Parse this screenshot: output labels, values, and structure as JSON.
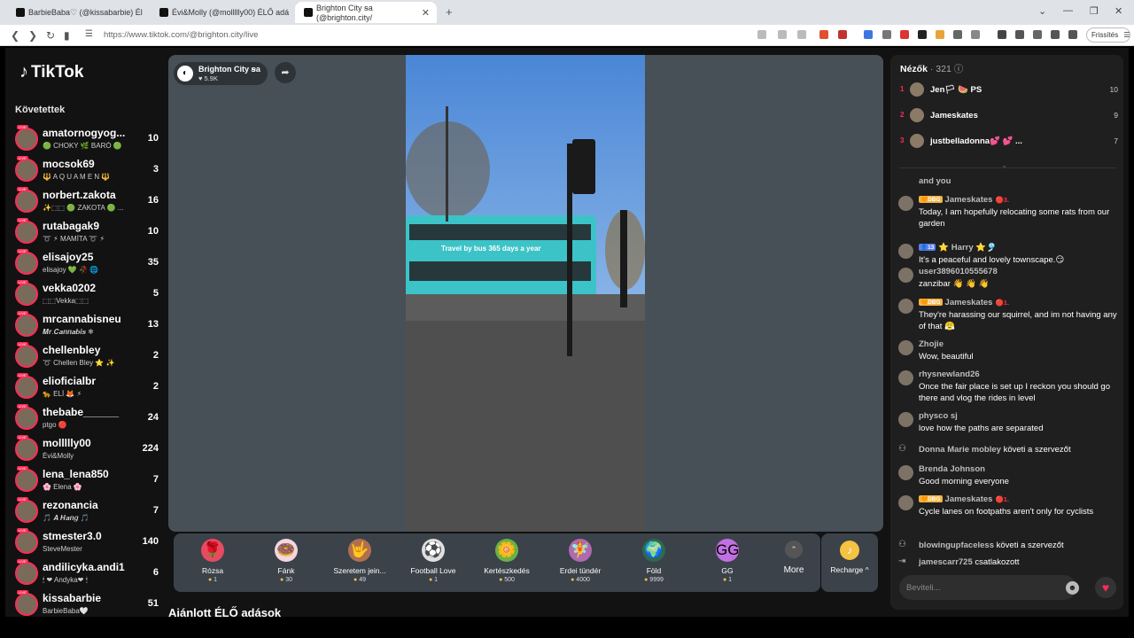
{
  "browser": {
    "tabs": [
      {
        "label": "BarbieBaba♡ (@kissabarbie) Él"
      },
      {
        "label": "Évi&Molly (@mollllly00) ÉLŐ adá"
      },
      {
        "label": "Brighton City ꞩa (@brighton.city/"
      }
    ],
    "url": "https://www.tiktok.com/@brighton.city/live",
    "update_label": "Frissítés"
  },
  "sidebar": {
    "logo": "TikTok",
    "following_heading": "Követettek",
    "live_badge": "LIVE",
    "items": [
      {
        "name": "amatornogyog...",
        "sub": "🟢 CHOKY 🌿 BARÓ 🟢",
        "count": "10"
      },
      {
        "name": "mocsok69",
        "sub": "🔱 A Q U A M E N 🔱",
        "count": "3"
      },
      {
        "name": "norbert.zakota",
        "sub": "✨⬚⬚ 🟢 ZAKOTA 🟢 ...",
        "count": "16"
      },
      {
        "name": "rutabagak9",
        "sub": "➰ ⚡ MAMÍTA ➰ ⚡",
        "count": "10"
      },
      {
        "name": "elisajoy25",
        "sub": "elisajoy 💚 🥀 🌐",
        "count": "35"
      },
      {
        "name": "vekka0202",
        "sub": "⬚⬚Vekka⬚⬚",
        "count": "5"
      },
      {
        "name": "mrcannabisneu",
        "sub": "𝑴𝒓.𝑪𝒂𝒏𝒏𝒂𝒃𝒊𝒔 ❄",
        "count": "13"
      },
      {
        "name": "chellenbley",
        "sub": "➰ Chellen Bley ⭐ ✨",
        "count": "2"
      },
      {
        "name": "elioficialbr",
        "sub": "🐆 ELÍ 🦊 ⚡",
        "count": "2"
      },
      {
        "name": "thebabe______",
        "sub": "ptgo 🔴",
        "count": "24"
      },
      {
        "name": "mollllly00",
        "sub": "Évi&Molly",
        "count": "224"
      },
      {
        "name": "lena_lena850",
        "sub": "🌸 Elena 🌸",
        "count": "7"
      },
      {
        "name": "rezonancia",
        "sub": "🎵 𝑨 𝑯𝒂𝒏𝒈 🎵",
        "count": "7"
      },
      {
        "name": "stmester3.0",
        "sub": "SteveMester",
        "count": "140"
      },
      {
        "name": "andilicyka.andi1",
        "sub": "🕯 ❤ Andyka❤ 🕯",
        "count": "6"
      },
      {
        "name": "kissabarbie",
        "sub": "BarbieBaba🤍",
        "count": "51"
      }
    ]
  },
  "stream": {
    "host_name": "Brighton City ꞩa",
    "host_likes": "♥ 5.9K",
    "bus_text": "Travel by bus 365 days a year",
    "recommended_heading": "Ajánlott ÉLŐ adások"
  },
  "gifts": [
    {
      "icon": "rose-icon",
      "glyph": "🌹",
      "name": "Rózsa",
      "price": "1"
    },
    {
      "icon": "donut-icon",
      "glyph": "🍩",
      "name": "Fánk",
      "price": "30"
    },
    {
      "icon": "hand-heart-icon",
      "glyph": "🤟",
      "name": "Szeretem jein...",
      "price": "49"
    },
    {
      "icon": "football-love-icon",
      "glyph": "⚽",
      "name": "Football Love",
      "price": "1"
    },
    {
      "icon": "garden-icon",
      "glyph": "🌼",
      "name": "Kertészkedés",
      "price": "500"
    },
    {
      "icon": "fairy-icon",
      "glyph": "🧚",
      "name": "Erdei tündér",
      "price": "4000"
    },
    {
      "icon": "earth-icon",
      "glyph": "🌍",
      "name": "Föld",
      "price": "9999"
    },
    {
      "icon": "gg-icon",
      "glyph": "GG",
      "name": "GG",
      "price": "1"
    }
  ],
  "gift_more_label": "More",
  "recharge_label": "Recharge ^",
  "viewers": {
    "title": "Nézők",
    "count": "· 321",
    "top": [
      {
        "rank": "1",
        "name": "Jen🏳 🍉 PS",
        "score": "10"
      },
      {
        "rank": "2",
        "name": "Jameskates",
        "score": "9"
      },
      {
        "rank": "3",
        "name": "justbelladonna💕 💕 ...",
        "score": "7"
      }
    ]
  },
  "chat": {
    "partial_top": "and you",
    "messages": [
      {
        "badge": "🧡DBG",
        "badge_type": "orange",
        "user": "Jameskates",
        "level": "🔴3.",
        "text": "Today, I am hopefully relocating some rats from our garden"
      },
      {
        "badge": "👤13",
        "badge_type": "blue",
        "user": "⭐ Harry ⭐🎐",
        "level": "",
        "text": "It's a peaceful and lovely townscape.😏"
      },
      {
        "badge": "",
        "badge_type": "",
        "user": "user3896010555678",
        "level": "",
        "text": "zanzibar 👋 👋 👋"
      },
      {
        "badge": "🧡DBG",
        "badge_type": "orange",
        "user": "Jameskates",
        "level": "🔴1.",
        "text": "They're harassing our squirrel, and im not having any of that 😤"
      },
      {
        "badge": "",
        "badge_type": "",
        "user": "Zhojie",
        "level": "",
        "text": "Wow, beautiful"
      },
      {
        "badge": "",
        "badge_type": "",
        "user": "rhysnewland26",
        "level": "",
        "text": "Once the fair place is set up I reckon you should go there and vlog the rides in level"
      },
      {
        "badge": "",
        "badge_type": "",
        "user": "physco sj",
        "level": "",
        "text": "love how the paths are separated"
      }
    ],
    "event1": {
      "user": "Donna Marie mobley",
      "action": "követi a szervezőt"
    },
    "messages2": [
      {
        "badge": "",
        "badge_type": "",
        "user": "Brenda Johnson",
        "level": "",
        "text": "Good morning everyone"
      },
      {
        "badge": "🧡DBG",
        "badge_type": "orange",
        "user": "Jameskates",
        "level": "🔴1.",
        "text": "Cycle lanes on footpaths aren't only for cyclists"
      }
    ],
    "event2": {
      "user": "blowingupfaceless",
      "action": "követi a szervezőt"
    },
    "event3": {
      "user": "jamescarr725",
      "action": "csatlakozott"
    },
    "input_placeholder": "Beviteli..."
  }
}
